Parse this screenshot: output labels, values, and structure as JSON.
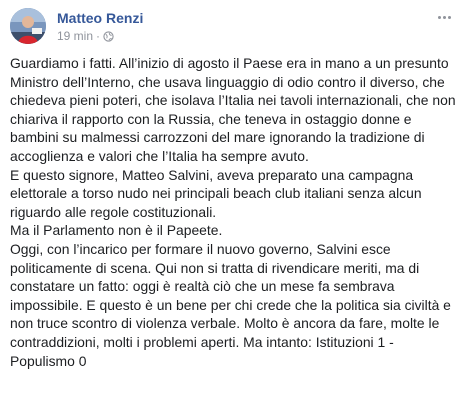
{
  "post": {
    "author": "Matteo Renzi",
    "time": "19 min",
    "separator": "·",
    "privacy_icon": "globe-icon",
    "more_icon": "more-options-icon",
    "avatar_icon": "profile-avatar",
    "paragraphs": [
      "Guardiamo i fatti. All’inizio di agosto il Paese era in mano a un presunto Ministro dell’Interno, che usava linguaggio di odio contro il diverso, che chiedeva pieni poteri, che isolava l’Italia nei tavoli internazionali, che non chiariva il rapporto con la Russia, che teneva in ostaggio donne e bambini su malmessi carrozzoni del mare ignorando la tradizione di accoglienza e valori che l’Italia ha sempre avuto.",
      "E questo signore, Matteo Salvini, aveva preparato una campagna elettorale a torso nudo nei principali beach club italiani senza alcun riguardo alle regole costituzionali.",
      "Ma il Parlamento non è il Papeete.",
      "Oggi, con l’incarico per formare il nuovo governo, Salvini esce politicamente di scena. Qui non si tratta di rivendicare meriti, ma di constatare un fatto: oggi è realtà ciò che un mese fa sembrava impossibile. E questo è un bene per chi crede che la politica sia civiltà e non truce scontro di violenza verbale. Molto è ancora da fare, molte le contraddizioni, molti i problemi aperti. Ma intanto: Istituzioni 1 - Populismo 0"
    ],
    "colors": {
      "author": "#365899",
      "text": "#1c1e21",
      "meta": "#90949c"
    }
  }
}
